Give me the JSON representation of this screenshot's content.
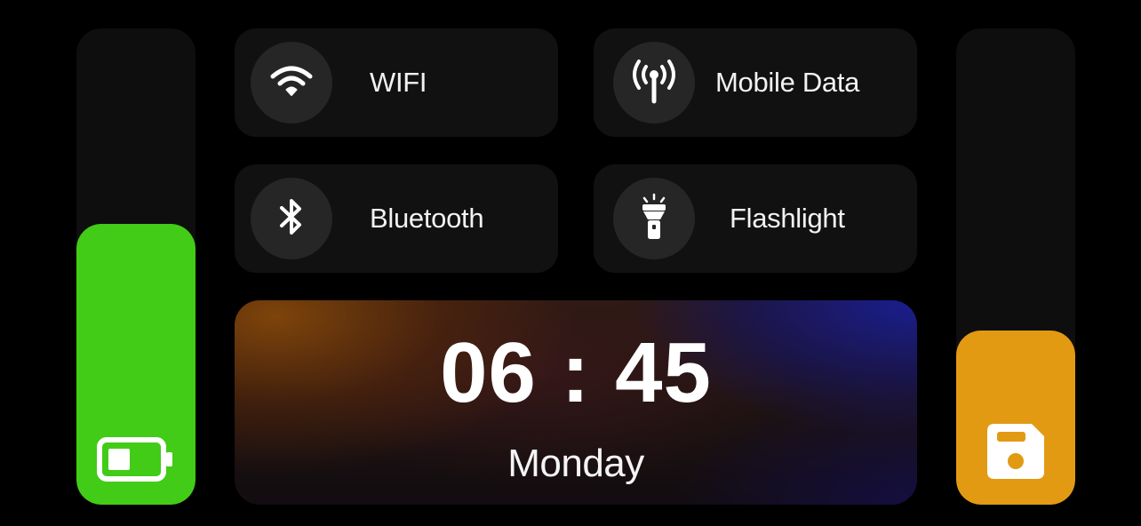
{
  "controls": {
    "wifi": {
      "label": "WIFI",
      "icon": "wifi-icon"
    },
    "mobile_data": {
      "label": "Mobile Data",
      "icon": "cellular-antenna-icon"
    },
    "bluetooth": {
      "label": "Bluetooth",
      "icon": "bluetooth-icon"
    },
    "flashlight": {
      "label": "Flashlight",
      "icon": "flashlight-icon"
    }
  },
  "battery_slider": {
    "icon": "battery-icon",
    "level_fraction": 0.59,
    "color": "#42cc17"
  },
  "save_slider": {
    "icon": "floppy-disk-icon",
    "level_fraction": 0.365,
    "color": "#e29a13"
  },
  "clock": {
    "time": "06 : 45",
    "day": "Monday"
  }
}
